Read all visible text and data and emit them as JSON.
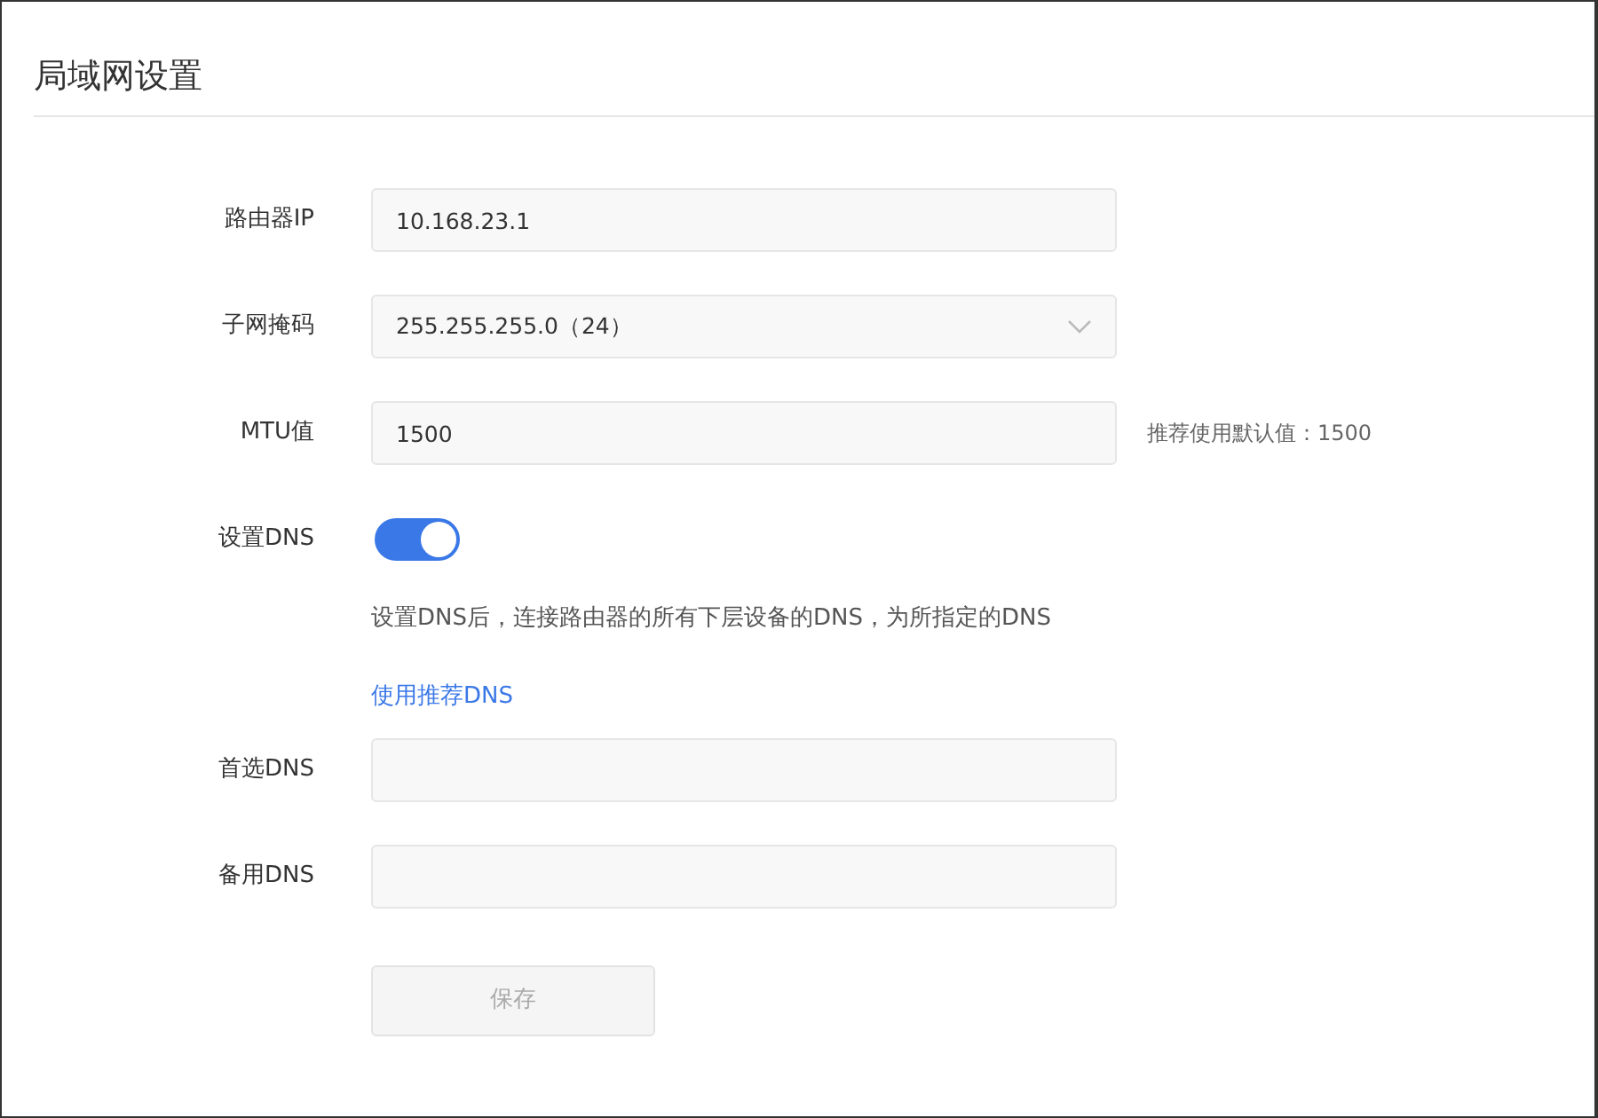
{
  "title": "局域网设置",
  "fields": [
    {
      "kind": "input",
      "label": "路由器IP",
      "value": "10.168.23.1"
    },
    {
      "kind": "select",
      "label": "子网掩码",
      "value": "255.255.255.0（24）"
    },
    {
      "kind": "input",
      "label": "MTU值",
      "value": "1500",
      "hint": "推荐使用默认值：1500"
    },
    {
      "kind": "toggle",
      "label": "设置DNS",
      "on": true,
      "note": "设置DNS后，连接路由器的所有下层设备的DNS，为所指定的DNS",
      "link": "使用推荐DNS"
    },
    {
      "kind": "input",
      "label": "首选DNS"
    },
    {
      "kind": "input",
      "label": "备用DNS"
    }
  ],
  "save_button": {
    "label": "保存",
    "disabled": true
  }
}
